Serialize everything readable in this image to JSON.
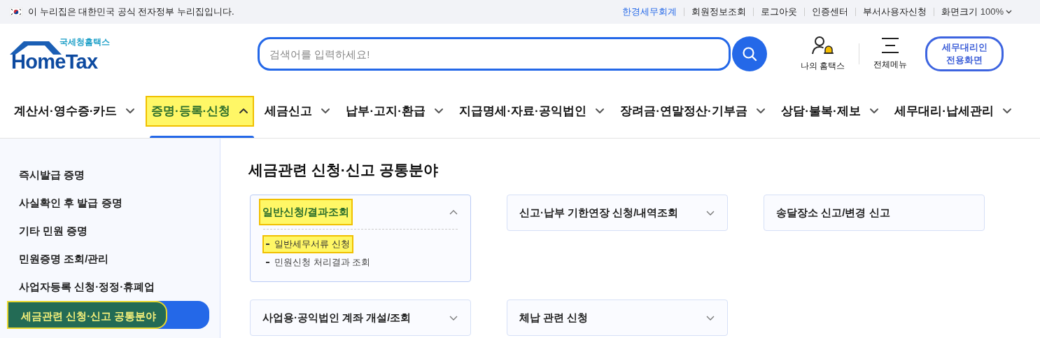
{
  "gov_banner": {
    "text": "이 누리집은 대한민국 공식 전자정부 누리집입니다."
  },
  "top_links": [
    {
      "label": "한경세무회계",
      "kind": "accent"
    },
    {
      "label": "회원정보조회",
      "kind": "plain"
    },
    {
      "label": "로그아웃",
      "kind": "plain"
    },
    {
      "label": "인증센터",
      "kind": "plain"
    },
    {
      "label": "부서사용자신청",
      "kind": "plain"
    }
  ],
  "zoom_control": {
    "label": "화면크기",
    "value": "100%"
  },
  "logo": {
    "subtitle": "국세청홈택스",
    "title": "HomeTax"
  },
  "search": {
    "placeholder": "검색어를 입력하세요!"
  },
  "quick_menu": [
    {
      "label": "나의 홈택스",
      "kind": "user"
    },
    {
      "label": "전체메뉴",
      "kind": "menu"
    }
  ],
  "agent_button": {
    "lines": [
      "세무대리인",
      "전용화면"
    ]
  },
  "nav": [
    {
      "label": "계산서·영수증·카드",
      "selected": false,
      "highlighted": false
    },
    {
      "label": "증명·등록·신청",
      "selected": true,
      "highlighted": true
    },
    {
      "label": "세금신고",
      "selected": false,
      "highlighted": false
    },
    {
      "label": "납부·고지·환급",
      "selected": false,
      "highlighted": false
    },
    {
      "label": "지급명세·자료·공익법인",
      "selected": false,
      "highlighted": false
    },
    {
      "label": "장려금·연말정산·기부금",
      "selected": false,
      "highlighted": false
    },
    {
      "label": "상담·불복·제보",
      "selected": false,
      "highlighted": false
    },
    {
      "label": "세무대리·납세관리",
      "selected": false,
      "highlighted": false
    }
  ],
  "sidebar": {
    "items": [
      {
        "label": "즉시발급 증명",
        "selected": false,
        "highlighted": false
      },
      {
        "label": "사실확인 후 발급 증명",
        "selected": false,
        "highlighted": false
      },
      {
        "label": "기타 민원 증명",
        "selected": false,
        "highlighted": false
      },
      {
        "label": "민원증명 조회/관리",
        "selected": false,
        "highlighted": false
      },
      {
        "label": "사업자등록 신청·정정·휴폐업",
        "selected": false,
        "highlighted": false
      },
      {
        "label": "세금관련 신청·신고 공통분야",
        "selected": true,
        "highlighted": true
      }
    ]
  },
  "main": {
    "title": "세금관련 신청·신고 공통분야",
    "cards": [
      {
        "title": "일반신청/결과조회",
        "expanded": true,
        "highlighted": true,
        "children": [
          {
            "label": "일반세무서류 신청",
            "highlighted": true
          },
          {
            "label": "민원신청 처리결과 조회",
            "highlighted": false
          }
        ]
      },
      {
        "title": "신고·납부 기한연장 신청/내역조회",
        "expanded": false,
        "highlighted": false
      },
      {
        "title": "송달장소 신고/변경 신고",
        "kind": "link",
        "expanded": false,
        "highlighted": false
      },
      {
        "title": "사업용·공익법인 계좌 개설/조회",
        "expanded": false,
        "highlighted": false
      },
      {
        "title": "체납 관련 신청",
        "expanded": false,
        "highlighted": false
      }
    ]
  }
}
